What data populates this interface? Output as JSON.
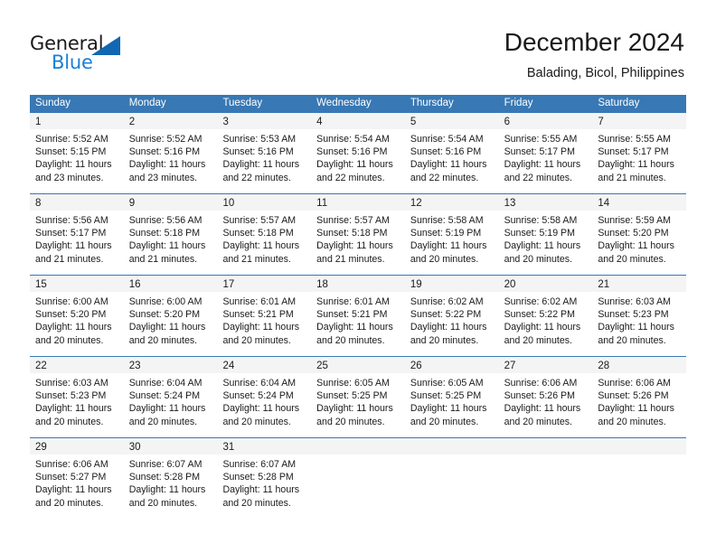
{
  "logo": {
    "word_one": "General",
    "word_two": "Blue",
    "triangle_icon": "blue-triangle-icon",
    "accent_dark": "#1267b2",
    "accent_light": "#1b7fd4"
  },
  "header": {
    "title": "December 2024",
    "subtitle": "Balading, Bicol, Philippines"
  },
  "theme": {
    "header_band": "#3878b4",
    "day_strip": "#f4f4f4",
    "text": "#1a1a1a"
  },
  "weekdays": [
    "Sunday",
    "Monday",
    "Tuesday",
    "Wednesday",
    "Thursday",
    "Friday",
    "Saturday"
  ],
  "weeks": [
    [
      {
        "day": "1",
        "sunrise": "Sunrise: 5:52 AM",
        "sunset": "Sunset: 5:15 PM",
        "daylight_1": "Daylight: 11 hours",
        "daylight_2": "and 23 minutes."
      },
      {
        "day": "2",
        "sunrise": "Sunrise: 5:52 AM",
        "sunset": "Sunset: 5:16 PM",
        "daylight_1": "Daylight: 11 hours",
        "daylight_2": "and 23 minutes."
      },
      {
        "day": "3",
        "sunrise": "Sunrise: 5:53 AM",
        "sunset": "Sunset: 5:16 PM",
        "daylight_1": "Daylight: 11 hours",
        "daylight_2": "and 22 minutes."
      },
      {
        "day": "4",
        "sunrise": "Sunrise: 5:54 AM",
        "sunset": "Sunset: 5:16 PM",
        "daylight_1": "Daylight: 11 hours",
        "daylight_2": "and 22 minutes."
      },
      {
        "day": "5",
        "sunrise": "Sunrise: 5:54 AM",
        "sunset": "Sunset: 5:16 PM",
        "daylight_1": "Daylight: 11 hours",
        "daylight_2": "and 22 minutes."
      },
      {
        "day": "6",
        "sunrise": "Sunrise: 5:55 AM",
        "sunset": "Sunset: 5:17 PM",
        "daylight_1": "Daylight: 11 hours",
        "daylight_2": "and 22 minutes."
      },
      {
        "day": "7",
        "sunrise": "Sunrise: 5:55 AM",
        "sunset": "Sunset: 5:17 PM",
        "daylight_1": "Daylight: 11 hours",
        "daylight_2": "and 21 minutes."
      }
    ],
    [
      {
        "day": "8",
        "sunrise": "Sunrise: 5:56 AM",
        "sunset": "Sunset: 5:17 PM",
        "daylight_1": "Daylight: 11 hours",
        "daylight_2": "and 21 minutes."
      },
      {
        "day": "9",
        "sunrise": "Sunrise: 5:56 AM",
        "sunset": "Sunset: 5:18 PM",
        "daylight_1": "Daylight: 11 hours",
        "daylight_2": "and 21 minutes."
      },
      {
        "day": "10",
        "sunrise": "Sunrise: 5:57 AM",
        "sunset": "Sunset: 5:18 PM",
        "daylight_1": "Daylight: 11 hours",
        "daylight_2": "and 21 minutes."
      },
      {
        "day": "11",
        "sunrise": "Sunrise: 5:57 AM",
        "sunset": "Sunset: 5:18 PM",
        "daylight_1": "Daylight: 11 hours",
        "daylight_2": "and 21 minutes."
      },
      {
        "day": "12",
        "sunrise": "Sunrise: 5:58 AM",
        "sunset": "Sunset: 5:19 PM",
        "daylight_1": "Daylight: 11 hours",
        "daylight_2": "and 20 minutes."
      },
      {
        "day": "13",
        "sunrise": "Sunrise: 5:58 AM",
        "sunset": "Sunset: 5:19 PM",
        "daylight_1": "Daylight: 11 hours",
        "daylight_2": "and 20 minutes."
      },
      {
        "day": "14",
        "sunrise": "Sunrise: 5:59 AM",
        "sunset": "Sunset: 5:20 PM",
        "daylight_1": "Daylight: 11 hours",
        "daylight_2": "and 20 minutes."
      }
    ],
    [
      {
        "day": "15",
        "sunrise": "Sunrise: 6:00 AM",
        "sunset": "Sunset: 5:20 PM",
        "daylight_1": "Daylight: 11 hours",
        "daylight_2": "and 20 minutes."
      },
      {
        "day": "16",
        "sunrise": "Sunrise: 6:00 AM",
        "sunset": "Sunset: 5:20 PM",
        "daylight_1": "Daylight: 11 hours",
        "daylight_2": "and 20 minutes."
      },
      {
        "day": "17",
        "sunrise": "Sunrise: 6:01 AM",
        "sunset": "Sunset: 5:21 PM",
        "daylight_1": "Daylight: 11 hours",
        "daylight_2": "and 20 minutes."
      },
      {
        "day": "18",
        "sunrise": "Sunrise: 6:01 AM",
        "sunset": "Sunset: 5:21 PM",
        "daylight_1": "Daylight: 11 hours",
        "daylight_2": "and 20 minutes."
      },
      {
        "day": "19",
        "sunrise": "Sunrise: 6:02 AM",
        "sunset": "Sunset: 5:22 PM",
        "daylight_1": "Daylight: 11 hours",
        "daylight_2": "and 20 minutes."
      },
      {
        "day": "20",
        "sunrise": "Sunrise: 6:02 AM",
        "sunset": "Sunset: 5:22 PM",
        "daylight_1": "Daylight: 11 hours",
        "daylight_2": "and 20 minutes."
      },
      {
        "day": "21",
        "sunrise": "Sunrise: 6:03 AM",
        "sunset": "Sunset: 5:23 PM",
        "daylight_1": "Daylight: 11 hours",
        "daylight_2": "and 20 minutes."
      }
    ],
    [
      {
        "day": "22",
        "sunrise": "Sunrise: 6:03 AM",
        "sunset": "Sunset: 5:23 PM",
        "daylight_1": "Daylight: 11 hours",
        "daylight_2": "and 20 minutes."
      },
      {
        "day": "23",
        "sunrise": "Sunrise: 6:04 AM",
        "sunset": "Sunset: 5:24 PM",
        "daylight_1": "Daylight: 11 hours",
        "daylight_2": "and 20 minutes."
      },
      {
        "day": "24",
        "sunrise": "Sunrise: 6:04 AM",
        "sunset": "Sunset: 5:24 PM",
        "daylight_1": "Daylight: 11 hours",
        "daylight_2": "and 20 minutes."
      },
      {
        "day": "25",
        "sunrise": "Sunrise: 6:05 AM",
        "sunset": "Sunset: 5:25 PM",
        "daylight_1": "Daylight: 11 hours",
        "daylight_2": "and 20 minutes."
      },
      {
        "day": "26",
        "sunrise": "Sunrise: 6:05 AM",
        "sunset": "Sunset: 5:25 PM",
        "daylight_1": "Daylight: 11 hours",
        "daylight_2": "and 20 minutes."
      },
      {
        "day": "27",
        "sunrise": "Sunrise: 6:06 AM",
        "sunset": "Sunset: 5:26 PM",
        "daylight_1": "Daylight: 11 hours",
        "daylight_2": "and 20 minutes."
      },
      {
        "day": "28",
        "sunrise": "Sunrise: 6:06 AM",
        "sunset": "Sunset: 5:26 PM",
        "daylight_1": "Daylight: 11 hours",
        "daylight_2": "and 20 minutes."
      }
    ],
    [
      {
        "day": "29",
        "sunrise": "Sunrise: 6:06 AM",
        "sunset": "Sunset: 5:27 PM",
        "daylight_1": "Daylight: 11 hours",
        "daylight_2": "and 20 minutes."
      },
      {
        "day": "30",
        "sunrise": "Sunrise: 6:07 AM",
        "sunset": "Sunset: 5:28 PM",
        "daylight_1": "Daylight: 11 hours",
        "daylight_2": "and 20 minutes."
      },
      {
        "day": "31",
        "sunrise": "Sunrise: 6:07 AM",
        "sunset": "Sunset: 5:28 PM",
        "daylight_1": "Daylight: 11 hours",
        "daylight_2": "and 20 minutes."
      },
      {
        "day": "",
        "sunrise": "",
        "sunset": "",
        "daylight_1": "",
        "daylight_2": ""
      },
      {
        "day": "",
        "sunrise": "",
        "sunset": "",
        "daylight_1": "",
        "daylight_2": ""
      },
      {
        "day": "",
        "sunrise": "",
        "sunset": "",
        "daylight_1": "",
        "daylight_2": ""
      },
      {
        "day": "",
        "sunrise": "",
        "sunset": "",
        "daylight_1": "",
        "daylight_2": ""
      }
    ]
  ]
}
